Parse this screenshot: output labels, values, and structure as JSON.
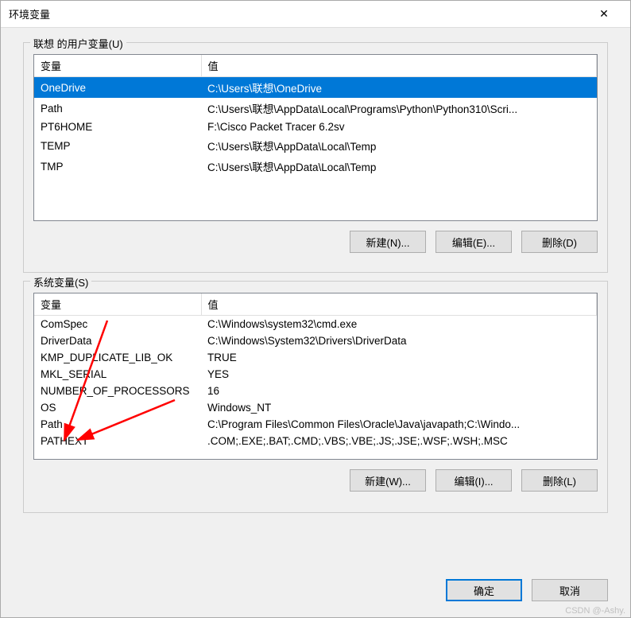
{
  "dialog_title": "环境变量",
  "close_glyph": "✕",
  "user_group": {
    "label": "联想 的用户变量(U)",
    "col_variable": "变量",
    "col_value": "值",
    "rows": [
      {
        "name": "OneDrive",
        "value": "C:\\Users\\联想\\OneDrive",
        "selected": true
      },
      {
        "name": "Path",
        "value": "C:\\Users\\联想\\AppData\\Local\\Programs\\Python\\Python310\\Scri...",
        "selected": false
      },
      {
        "name": "PT6HOME",
        "value": "F:\\Cisco Packet Tracer 6.2sv",
        "selected": false
      },
      {
        "name": "TEMP",
        "value": "C:\\Users\\联想\\AppData\\Local\\Temp",
        "selected": false
      },
      {
        "name": "TMP",
        "value": "C:\\Users\\联想\\AppData\\Local\\Temp",
        "selected": false
      }
    ],
    "btn_new": "新建(N)...",
    "btn_edit": "编辑(E)...",
    "btn_delete": "删除(D)"
  },
  "sys_group": {
    "label": "系统变量(S)",
    "col_variable": "变量",
    "col_value": "值",
    "rows": [
      {
        "name": "ComSpec",
        "value": "C:\\Windows\\system32\\cmd.exe"
      },
      {
        "name": "DriverData",
        "value": "C:\\Windows\\System32\\Drivers\\DriverData"
      },
      {
        "name": "KMP_DUPLICATE_LIB_OK",
        "value": "TRUE"
      },
      {
        "name": "MKL_SERIAL",
        "value": "YES"
      },
      {
        "name": "NUMBER_OF_PROCESSORS",
        "value": "16"
      },
      {
        "name": "OS",
        "value": "Windows_NT"
      },
      {
        "name": "Path",
        "value": "C:\\Program Files\\Common Files\\Oracle\\Java\\javapath;C:\\Windo..."
      },
      {
        "name": "PATHEXT",
        "value": ".COM;.EXE;.BAT;.CMD;.VBS;.VBE;.JS;.JSE;.WSF;.WSH;.MSC"
      }
    ],
    "btn_new": "新建(W)...",
    "btn_edit": "编辑(I)...",
    "btn_delete": "删除(L)"
  },
  "footer": {
    "ok": "确定",
    "cancel": "取消"
  },
  "watermark": "CSDN @-Ashy."
}
